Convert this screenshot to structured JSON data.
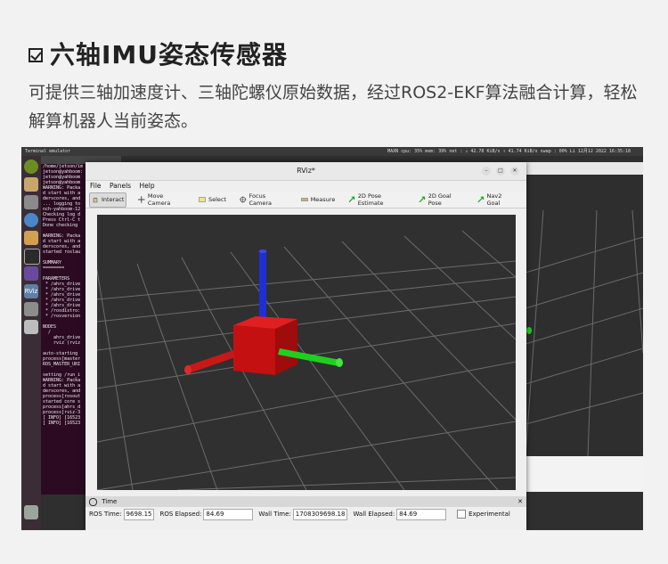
{
  "heading": {
    "title": "六轴IMU姿态传感器",
    "description": "可提供三轴加速度计、三轴陀螺仪原始数据，经过ROS2-EKF算法融合计算，轻松解算机器人当前姿态。"
  },
  "desktop": {
    "terminal_title": "Terminal emulator",
    "tray_text": "MAXN   cpu: 35% mem: 39% net :  ↓ 42.78 KiB/s ↑ 41.74 KiB/s swap : 00%      Li 12月12 2022   16:35:18",
    "terminal_lines": [
      "/home/jetson/im",
      "jetson@yahboom:",
      "jetson@yahboom",
      "jetson@yahboom",
      "WARNING: Packa",
      "d start with a",
      "derscores, and",
      "... logging to",
      "nch-yahboom-12",
      "Checking log d",
      "Press Ctrl-C t",
      "Done checking",
      "",
      "WARNING: Packa",
      "d start with a",
      "derscores, and",
      "started roslau",
      "",
      "SUMMARY",
      "========",
      "",
      "PARAMETERS",
      " * /ahrs_drive",
      " * /ahrs_drive",
      " * /ahrs_drive",
      " * /ahrs_drive",
      " * /ahrs_drive",
      " * /rosdistro:",
      " * /rosversion",
      "",
      "NODES",
      "  /",
      "    ahrs_drive",
      "    rviz (rviz",
      "",
      "auto-starting",
      "process[master",
      "ROS_MASTER_URI",
      "",
      "setting /run_i",
      "WARNING: Packa",
      "d start with a",
      "derscores, and",
      "process[rosout",
      "started core s",
      "process[ahrs_d",
      "process[rviz-3",
      "[ INFO] [16523",
      "[ INFO] [16523"
    ]
  },
  "rviz": {
    "window_title": "RViz*",
    "menu": [
      "File",
      "Panels",
      "Help"
    ],
    "tools": [
      "Interact",
      "Move Camera",
      "Select",
      "Focus Camera",
      "Measure",
      "2D Pose Estimate",
      "2D Goal Pose",
      "Nav2 Goal"
    ],
    "time_panel": {
      "title": "Time",
      "ros_time_label": "ROS Time:",
      "ros_time": "9698.15",
      "ros_elapsed_label": "ROS Elapsed:",
      "ros_elapsed": "84.69",
      "wall_time_label": "Wall Time:",
      "wall_time": "1708309698.18",
      "wall_elapsed_label": "Wall Elapsed:",
      "wall_elapsed": "84.69",
      "experimental_label": "Experimental"
    }
  },
  "colors": {
    "x_axis": "#d11f1f",
    "y_axis": "#1fcf1f",
    "z_axis": "#1f2fd8",
    "imu_box": "#cc1010",
    "viewport_bg": "#303030"
  }
}
